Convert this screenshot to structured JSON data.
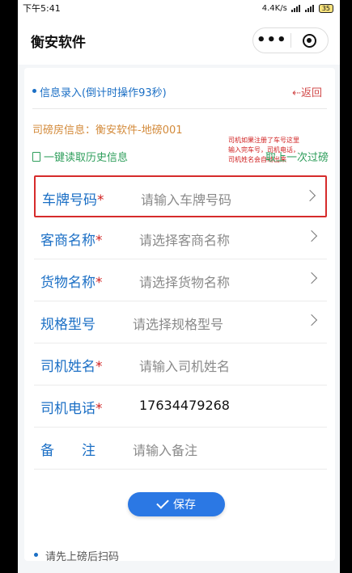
{
  "status_bar": {
    "time": "下午5:41",
    "network_speed": "4.4K/s",
    "battery": "35"
  },
  "nav": {
    "title": "衡安软件",
    "more_icon": "more-dots-icon",
    "target_icon": "target-icon"
  },
  "info": {
    "label": "信息录入(倒计时操作93秒)",
    "back": "⇠返回"
  },
  "weigh_room": "司磅房信息：衡安软件-地磅001",
  "history": {
    "read_label": "一键读取历史信息",
    "last_label": "取上一次过磅"
  },
  "tip_note": "司机如果注册了车号这里输入完车号，司机电话，司机姓名会自动出来",
  "fields": [
    {
      "label": "车牌号码",
      "required": "*",
      "value": "请输入车牌号码",
      "arrow": true
    },
    {
      "label": "客商名称",
      "required": "*",
      "value": "请选择客商名称",
      "arrow": true
    },
    {
      "label": "货物名称",
      "required": "*",
      "value": "请选择货物名称",
      "arrow": true
    },
    {
      "label": "规格型号",
      "required": "",
      "value": "请选择规格型号",
      "arrow": true
    },
    {
      "label": "司机姓名",
      "required": "*",
      "value": "请输入司机姓名",
      "arrow": false
    },
    {
      "label": "司机电话",
      "required": "*",
      "value": "17634479268",
      "arrow": false
    },
    {
      "label": "备　　注",
      "required": "",
      "value": "请输入备注",
      "arrow": false
    }
  ],
  "save_label": "保存",
  "footer_tip": "请先上磅后扫码",
  "colors": {
    "primary": "#2b78e4",
    "label_blue": "#1b6fc5",
    "required_red": "#d02020",
    "success_green": "#2e9e5b"
  }
}
